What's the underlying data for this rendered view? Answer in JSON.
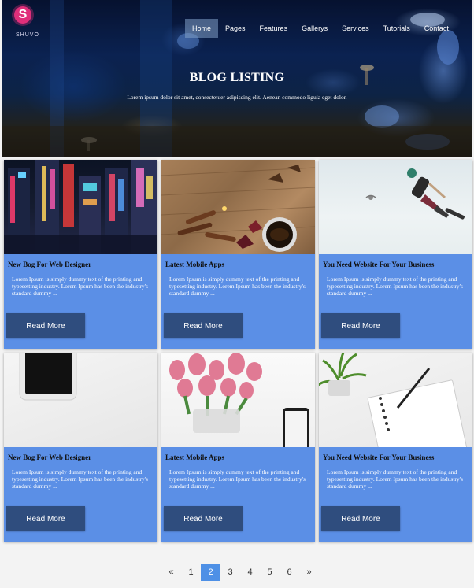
{
  "brand": {
    "initial": "S",
    "name": "SHUVO"
  },
  "nav": {
    "items": [
      "Home",
      "Pages",
      "Features",
      "Gallerys",
      "Services",
      "Tutorials",
      "Contact"
    ],
    "active": "Home"
  },
  "hero": {
    "title": "BLOG LISTING",
    "subtitle": "Lorem ipsum dolor sit amet, consectetuer adipiscing elit. Aenean commodo ligula eget dolor."
  },
  "cards": [
    {
      "title": "New Bog For Web Designer",
      "excerpt": "Lorem Ipsum is simply dummy text of the printing and typesetting industry. Lorem Ipsum has been the industry's standard dummy ...",
      "button": "Read More",
      "image": "neon-city-street-night"
    },
    {
      "title": "Latest Mobile Apps",
      "excerpt": "Lorem Ipsum is simply dummy text of the printing and typesetting industry. Lorem Ipsum has been the industry's standard dummy ...",
      "button": "Read More",
      "image": "tea-cup-cinnamon-on-wood"
    },
    {
      "title": "You Need Website For Your Business",
      "excerpt": "Lorem Ipsum is simply dummy text of the printing and typesetting industry. Lorem Ipsum has been the industry's standard dummy ...",
      "button": "Read More",
      "image": "skateboarder-jump-sky"
    },
    {
      "title": "New Bog For Web Designer",
      "excerpt": "Lorem Ipsum is simply dummy text of the printing and typesetting industry. Lorem Ipsum has been the industry's standard dummy ...",
      "button": "Read More",
      "image": "tablet-on-white-desk"
    },
    {
      "title": "Latest Mobile Apps",
      "excerpt": "Lorem Ipsum is simply dummy text of the printing and typesetting industry. Lorem Ipsum has been the industry's standard dummy ...",
      "button": "Read More",
      "image": "pink-tulips-and-phone"
    },
    {
      "title": "You Need Website For Your Business",
      "excerpt": "Lorem Ipsum is simply dummy text of the printing and typesetting industry. Lorem Ipsum has been the industry's standard dummy ...",
      "button": "Read More",
      "image": "notebook-pen-plant"
    }
  ],
  "pagination": {
    "prev": "«",
    "pages": [
      "1",
      "2",
      "3",
      "4",
      "5",
      "6"
    ],
    "active": "2",
    "next": "»"
  },
  "colors": {
    "card": "#5b8fe6",
    "button": "#2f4d7e",
    "active_page": "#4e90e6",
    "logo": "#e02f7a"
  }
}
